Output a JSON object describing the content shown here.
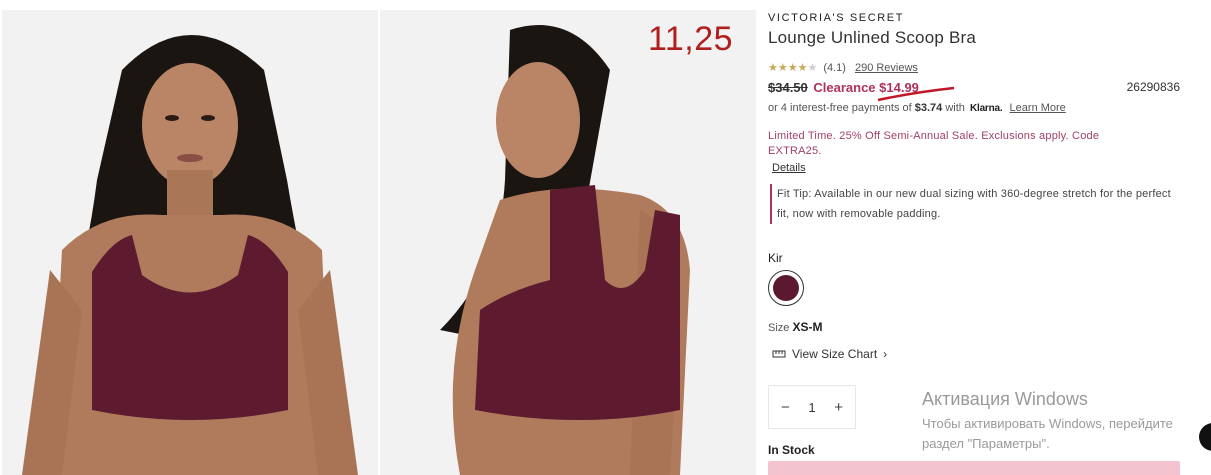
{
  "price_annotation": "11,25",
  "product": {
    "brand": "VICTORIA'S SECRET",
    "title": "Lounge Unlined Scoop Bra",
    "stars": "★★★★",
    "star_off": "★",
    "rating": "(4.1)",
    "reviews": "290 Reviews",
    "old_price": "$34.50",
    "clearance": "Clearance $14.99",
    "sku": "26290836",
    "klarna_prefix": "or 4 interest-free payments of",
    "klarna_amount": "$3.74",
    "klarna_with": "with",
    "klarna_brand": "Klarna.",
    "klarna_link": "Learn More",
    "promo": "Limited Time. 25% Off Semi-Annual Sale. Exclusions apply. Code EXTRA25.",
    "details": "Details",
    "fit_tip": "Fit Tip: Available in our new dual sizing with 360-degree stretch for the perfect fit, now with removable padding.",
    "color_name": "Kir",
    "size_label": "Size",
    "size_value": "XS-M",
    "size_chart": "View Size Chart",
    "qty_minus": "−",
    "qty_value": "1",
    "qty_plus": "+",
    "stock": "In Stock",
    "swatch_color": "#5c1830"
  },
  "windows": {
    "title": "Активация Windows",
    "line1": "Чтобы активировать Windows, перейдите",
    "line2": "раздел \"Параметры\"."
  }
}
